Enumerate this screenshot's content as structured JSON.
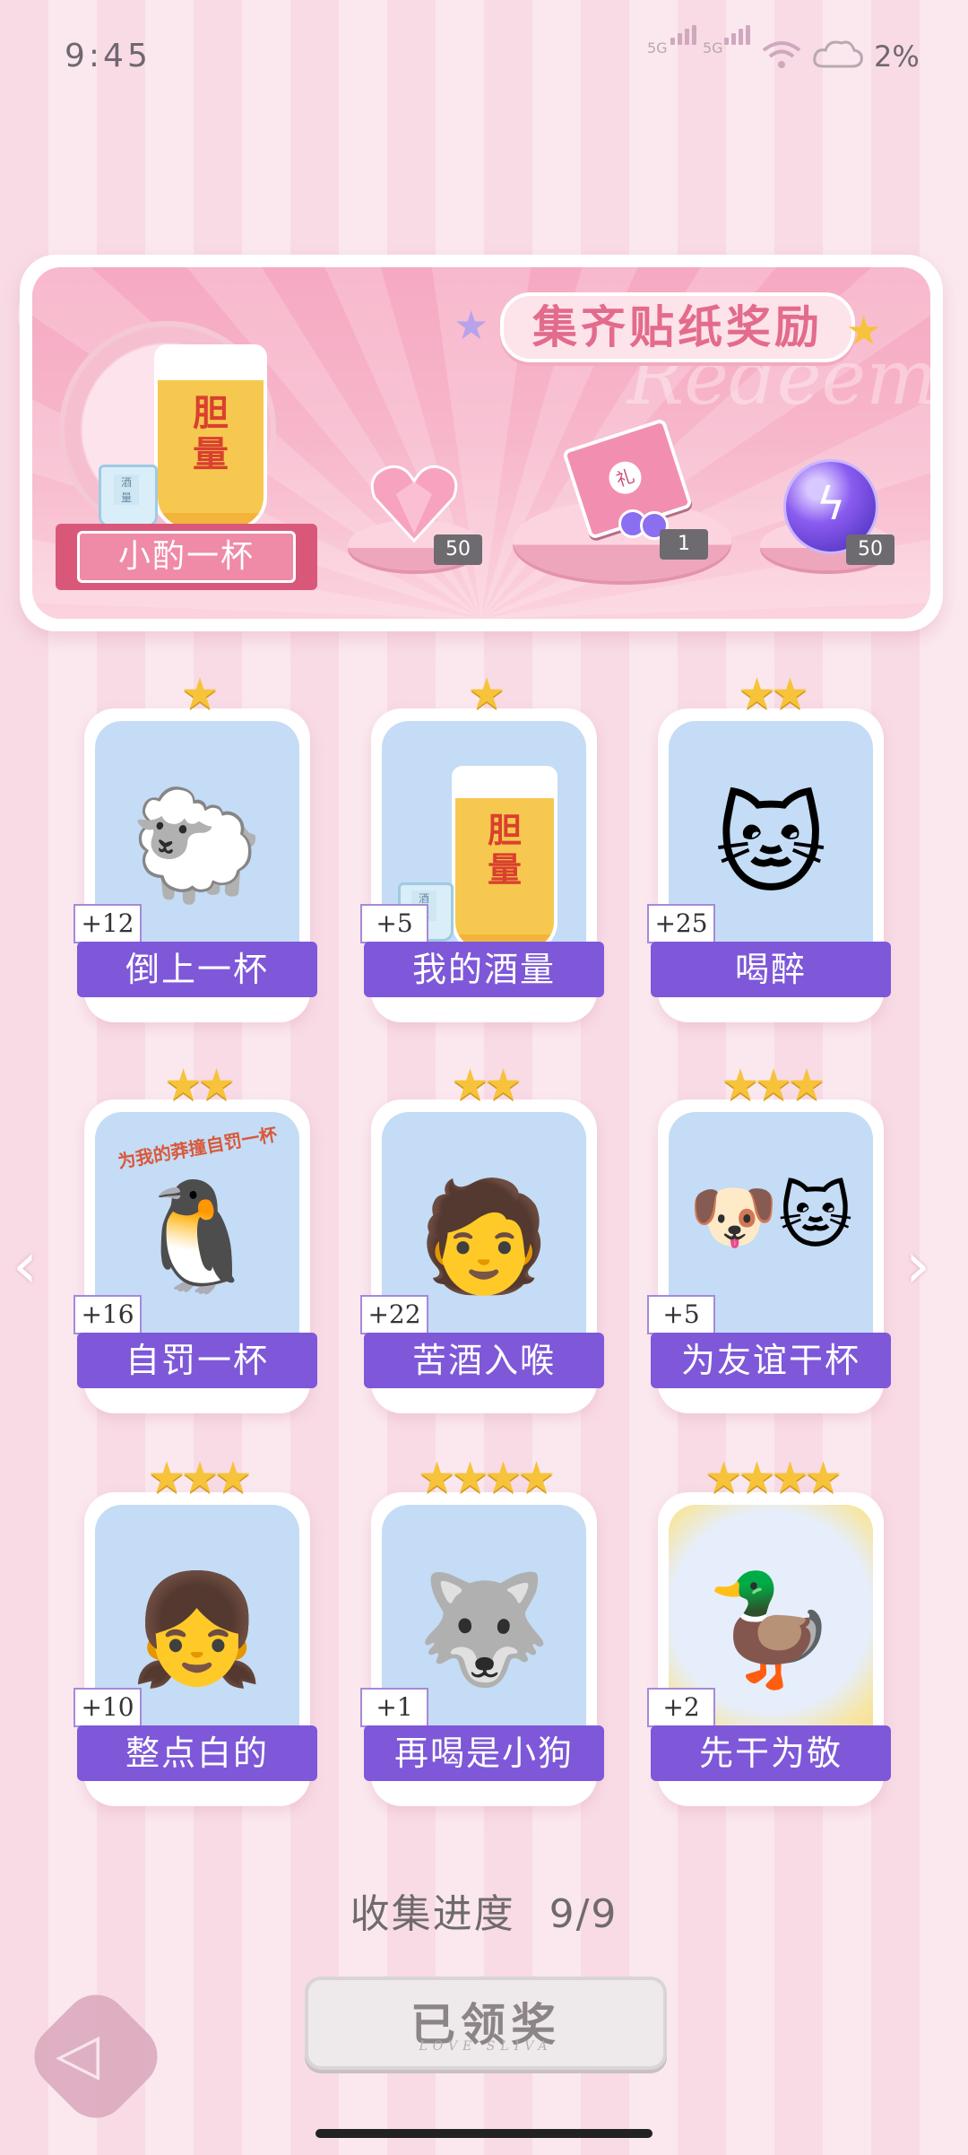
{
  "status_bar": {
    "time": "9:45",
    "sig1": "5G",
    "sig2": "5G",
    "battery": "2%"
  },
  "banner": {
    "title": "集齐贴纸奖励",
    "watermark": "Redeem",
    "main_prize": {
      "label": "小酌一杯",
      "glass_text": "胆\n量",
      "cup_text": "酒\n量"
    },
    "rewards": [
      {
        "icon": "heart-gem-icon",
        "count": "50"
      },
      {
        "icon": "gift-box-icon",
        "gift_char": "礼",
        "count": "1"
      },
      {
        "icon": "energy-orb-icon",
        "count": "50"
      }
    ]
  },
  "cards": [
    {
      "title": "倒上一杯",
      "bonus": "+12",
      "stars": "★",
      "icon": "sheep-pouring-beer"
    },
    {
      "title": "我的酒量",
      "bonus": "+5",
      "stars": "★",
      "icon": "beer-glass",
      "glass_text": "胆\n量",
      "cup_text": "酒\n量"
    },
    {
      "title": "喝醉",
      "bonus": "+25",
      "stars": "★★",
      "icon": "drunk-cat"
    },
    {
      "title": "自罚一杯",
      "bonus": "+16",
      "stars": "★★",
      "icon": "penguin-glass",
      "caption": "为我的莽撞自罚一杯"
    },
    {
      "title": "苦酒入喉",
      "bonus": "+22",
      "stars": "★★",
      "icon": "sad-boy-beer"
    },
    {
      "title": "为友谊干杯",
      "bonus": "+5",
      "stars": "★★★",
      "icon": "dog-cat-cheers"
    },
    {
      "title": "整点白的",
      "bonus": "+10",
      "stars": "★★★",
      "icon": "girl-bottle"
    },
    {
      "title": "再喝是小狗",
      "bonus": "+1",
      "stars": "★★★★",
      "icon": "husky-beer"
    },
    {
      "title": "先干为敬",
      "bonus": "+2",
      "stars": "★★★★",
      "icon": "duck-beer"
    }
  ],
  "progress": {
    "label": "收集进度",
    "value": "9/9"
  },
  "claim_button": {
    "label": "已领奖",
    "sub": "LOVE SLIVA"
  },
  "colors": {
    "label_purple": "#7e58d8",
    "pink": "#f6a9c2",
    "star": "#f6c33a"
  }
}
